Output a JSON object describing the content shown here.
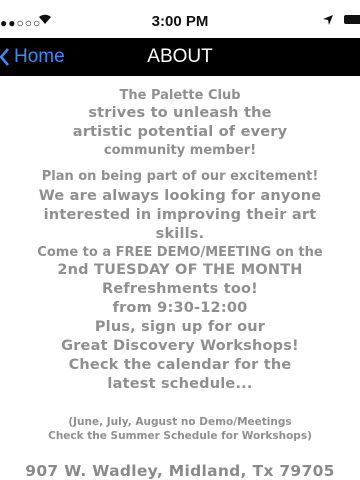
{
  "status_bar": {
    "signal": "●●○○○",
    "time": "3:00 PM"
  },
  "nav": {
    "back_label": "Home",
    "title": "ABOUT"
  },
  "content": {
    "intro": [
      "The Palette Club",
      "strives to unleash the",
      "artistic potential of every",
      "community member!"
    ],
    "plan": "Plan on being part of our excitement!",
    "looking": [
      "We are always looking for anyone",
      "interested in improving their art",
      "skills."
    ],
    "demo": [
      "Come to a FREE DEMO/MEETING on the",
      "2nd TUESDAY OF THE MONTH",
      "Refreshments too!",
      "from 9:30-12:00",
      "Plus, sign up for our",
      "Great Discovery Workshops!",
      "Check the calendar for the",
      "latest schedule..."
    ],
    "notes": [
      "(June, July, August no Demo/Meetings",
      "Check the Summer Schedule for Workshops)"
    ],
    "address": "907 W. Wadley, Midland, Tx 79705"
  }
}
